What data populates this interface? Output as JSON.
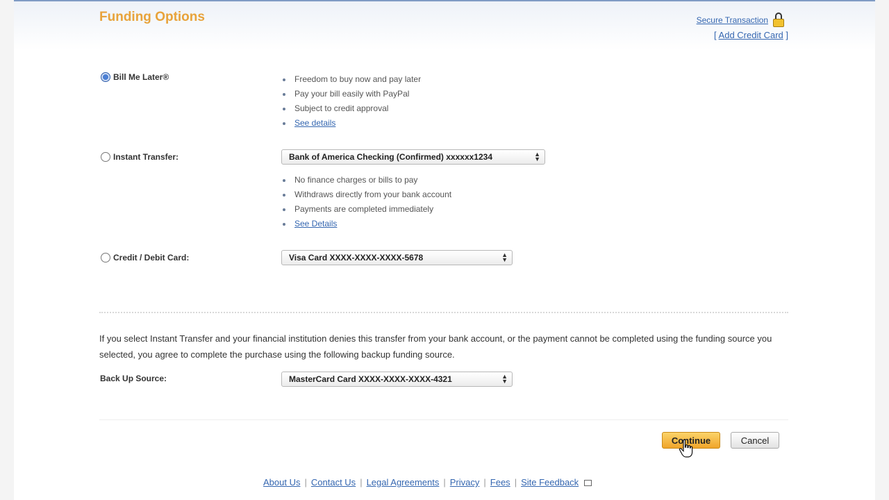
{
  "header": {
    "title": "Funding Options",
    "secure_link": "Secure Transaction",
    "add_card_open": "[ ",
    "add_card_link": "Add Credit Card",
    "add_card_close": " ]"
  },
  "options": [
    {
      "label": "Bill Me Later®",
      "checked": true,
      "bullets": [
        "Freedom to buy now and pay later",
        "Pay your bill easily with PayPal",
        "Subject to credit approval"
      ],
      "link": "See details"
    },
    {
      "label": "Instant Transfer:",
      "checked": false,
      "select_value": "Bank of America Checking (Confirmed) xxxxxx1234",
      "bullets": [
        "No finance charges or bills to pay",
        "Withdraws directly from your bank account",
        "Payments are completed immediately"
      ],
      "link": "See Details"
    },
    {
      "label": "Credit / Debit Card:",
      "checked": false,
      "select_value": "Visa Card XXXX-XXXX-XXXX-5678"
    }
  ],
  "notice": "If you select Instant Transfer and your financial institution denies this transfer from your bank account, or the payment cannot be completed using the funding source you selected, you agree to complete the purchase using the following backup funding source.",
  "backup": {
    "label": "Back Up Source:",
    "select_value": "MasterCard Card XXXX-XXXX-XXXX-4321"
  },
  "buttons": {
    "continue": "Continue",
    "cancel": "Cancel"
  },
  "footer": {
    "links": [
      "About Us",
      "Contact Us",
      "Legal Agreements",
      "Privacy",
      "Fees",
      "Site Feedback"
    ],
    "ext_marker": "[+]"
  },
  "colors": {
    "title": "#e8a33b",
    "link": "#3466b0",
    "continue_button": "#f0a52a"
  }
}
